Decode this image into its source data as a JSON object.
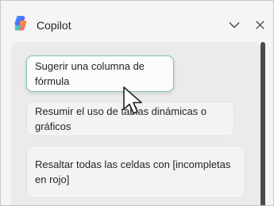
{
  "header": {
    "title": "Copilot",
    "icons": [
      "copilot-logo",
      "chevron-down-icon",
      "close-icon"
    ]
  },
  "suggestions": [
    {
      "label": "Sugerir una columna de fórmula"
    },
    {
      "label": "Resumir el uso de tablas dinámicas o gráficos"
    },
    {
      "label": "Resaltar todas las celdas con [incompletas en rojo]"
    }
  ],
  "colors": {
    "hover_border": "#79c99a",
    "panel_bg": "#f5f5f5",
    "list_bg": "#ebebeb"
  }
}
